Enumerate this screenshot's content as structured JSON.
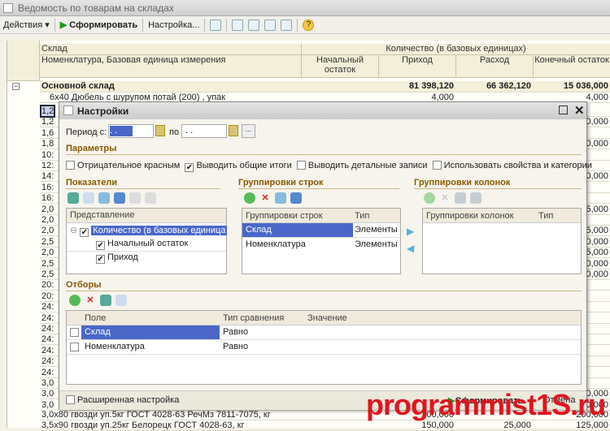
{
  "window": {
    "title": "Ведомость по товарам на складах"
  },
  "toolbar": {
    "actions": "Действия ▾",
    "generate": "Сформировать",
    "settings": "Настройка..."
  },
  "report": {
    "headers": {
      "group": "Склад",
      "item": "Номенклатура, Базовая единица измерения",
      "qty": "Количество (в базовых единицах)",
      "start": "Начальный остаток",
      "in": "Приход",
      "out": "Расход",
      "end": "Конечный остаток"
    },
    "total": {
      "name": "Основной склад",
      "in": "81 398,120",
      "out": "66 362,120",
      "end": "15 036,000"
    },
    "first_row": {
      "name": "6x40 Дюбель с шурупом потай (200) , упак",
      "in": "4,000",
      "end": "4,000"
    },
    "stubs": [
      "1,2",
      "1,2",
      "1,6",
      "1,8",
      "10:",
      "12:",
      "14:",
      "16:",
      "16:",
      "2,0",
      "2,0",
      "2,0",
      "2,5",
      "2,0",
      "2,5",
      "2,5",
      "20:",
      "20:",
      "24:",
      "24:",
      "24:",
      "24:",
      "24:",
      "24:",
      "24:",
      "3,0",
      "3,0",
      "3,0"
    ],
    "right_values": [
      "",
      "0,000",
      "",
      "0,000",
      "",
      "",
      "0,000",
      "",
      "",
      "5,000",
      "",
      "5,000",
      "0,000",
      "5,000",
      "0,000",
      "0,000",
      "",
      "",
      "",
      "",
      "",
      "",
      "",
      "",
      "",
      "",
      "0,000",
      "0,000"
    ],
    "bottom_rows": [
      {
        "name": "3,0x80 гвозди уп.5кг ГОСТ 4028-63 РечМз 7811-7075, кг",
        "in": "200,000",
        "out": "",
        "end": "200,000"
      },
      {
        "name": "3,5x90 гвозди уп.25кг Белорецк ГОСТ 4028-63, кг",
        "in": "150,000",
        "out": "25,000",
        "end": "125,000"
      }
    ]
  },
  "dialog": {
    "title": "Настройки",
    "period_from_label": "Период с:",
    "period_from": " . . ",
    "period_to_label": "по",
    "period_to": " . . ",
    "period_btn": "...",
    "params_title": "Параметры",
    "params": [
      {
        "label": "Отрицательное красным",
        "checked": false
      },
      {
        "label": "Выводить общие итоги",
        "checked": true
      },
      {
        "label": "Выводить детальные записи",
        "checked": false
      },
      {
        "label": "Использовать свойства и категории",
        "checked": false
      }
    ],
    "indicators": {
      "title": "Показатели",
      "col": "Представление",
      "items": [
        "Количество (в базовых единица",
        "Начальный остаток",
        "Приход"
      ]
    },
    "row_groups": {
      "title": "Группировки строк",
      "col1": "Группировки строк",
      "col2": "Тип",
      "rows": [
        {
          "name": "Склад",
          "type": "Элементы"
        },
        {
          "name": "Номенклатура",
          "type": "Элементы"
        }
      ]
    },
    "col_groups": {
      "title": "Группировки колонок",
      "col1": "Группировки колонок",
      "col2": "Тип"
    },
    "filters": {
      "title": "Отборы",
      "col1": "Поле",
      "col2": "Тип сравнения",
      "col3": "Значение",
      "rows": [
        {
          "field": "Склад",
          "cmp": "Равно"
        },
        {
          "field": "Номенклатура",
          "cmp": "Равно"
        }
      ]
    },
    "advanced": "Расширенная настройка",
    "ok": "Сформировать",
    "cancel": "Отмена"
  },
  "watermark": "programmist1S.ru",
  "colors": {
    "selection": "#4a67c8",
    "section": "#8a5a00",
    "watermark": "#e0141e"
  }
}
